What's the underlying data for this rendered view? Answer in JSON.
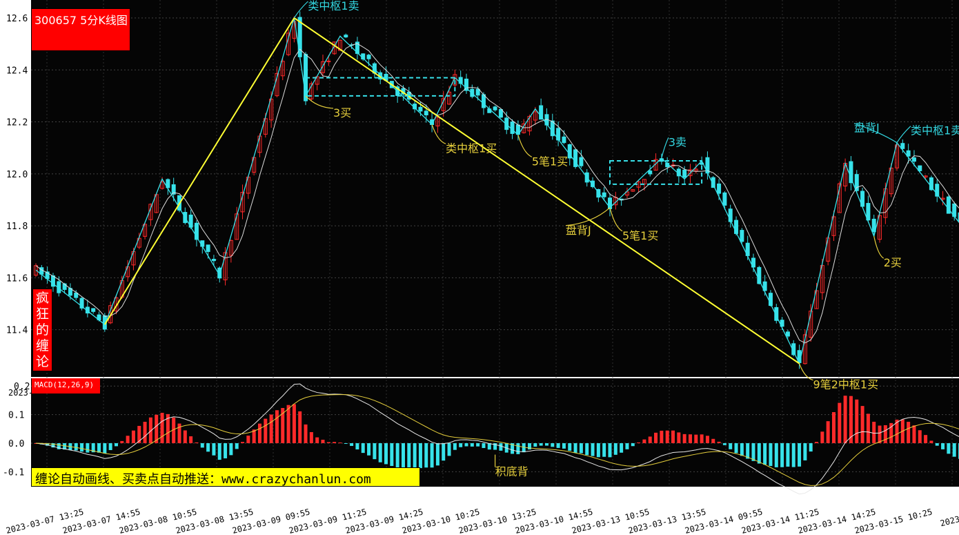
{
  "chart_data": {
    "type": "candlestick",
    "title": "300657 5分K线图",
    "side_label": "疯狂的缠论",
    "indicator_label": "MACD(12,26,9)",
    "promo_text": "缠论自动画线、买卖点自动推送：www.crazychanlun.com",
    "y_ticks": [
      "12.6",
      "12.4",
      "12.2",
      "12.0",
      "11.8",
      "11.6",
      "11.4"
    ],
    "ylim": [
      11.25,
      12.65
    ],
    "macd_ticks": [
      "0.2",
      "0.1",
      "0.0",
      "-0.1"
    ],
    "macd_ylim": [
      -0.13,
      0.21
    ],
    "x_ticks": [
      "2023-03-07 13:25",
      "2023-03-07 14:55",
      "2023-03-08 10:55",
      "2023-03-08 13:55",
      "2023-03-09 09:55",
      "2023-03-09 11:25",
      "2023-03-09 14:25",
      "2023-03-10 10:25",
      "2023-03-10 13:25",
      "2023-03-10 14:55",
      "2023-03-13 10:55",
      "2023-03-13 13:55",
      "2023-03-14 09:55",
      "2023-03-14 11:25",
      "2023-03-14 14:25",
      "2023-03-15 10:25",
      "2023-03-15"
    ],
    "x_tick_partial": "2023-",
    "bi_points": [
      {
        "i": 0,
        "p": 11.63
      },
      {
        "i": 12,
        "p": 11.42
      },
      {
        "i": 22,
        "p": 11.98
      },
      {
        "i": 32,
        "p": 11.61
      },
      {
        "i": 45,
        "p": 12.6
      },
      {
        "i": 47,
        "p": 12.3
      },
      {
        "i": 53,
        "p": 12.53
      },
      {
        "i": 69,
        "p": 12.19
      },
      {
        "i": 73,
        "p": 12.37
      },
      {
        "i": 84,
        "p": 12.15
      },
      {
        "i": 87,
        "p": 12.25
      },
      {
        "i": 100,
        "p": 11.87
      },
      {
        "i": 109,
        "p": 12.06
      },
      {
        "i": 113,
        "p": 11.98
      },
      {
        "i": 116,
        "p": 12.05
      },
      {
        "i": 133,
        "p": 11.27
      },
      {
        "i": 141,
        "p": 12.04
      },
      {
        "i": 146,
        "p": 11.76
      },
      {
        "i": 150,
        "p": 12.12
      },
      {
        "i": 162,
        "p": 11.78
      }
    ],
    "segment_points": [
      {
        "i": 12,
        "p": 11.42
      },
      {
        "i": 45,
        "p": 12.6
      },
      {
        "i": 133,
        "p": 11.27
      }
    ],
    "zhongshu": [
      {
        "i0": 47,
        "i1": 73,
        "low": 12.3,
        "high": 12.37
      },
      {
        "i0": 100,
        "i1": 116,
        "low": 11.96,
        "high": 12.05
      }
    ],
    "annotations": [
      {
        "text": "类中枢1卖",
        "color": "#33d6e0",
        "i": 45,
        "p": 12.6
      },
      {
        "text": "3买",
        "color": "#e6cf3c",
        "i": 47,
        "p": 12.3
      },
      {
        "text": "类中枢1买",
        "color": "#e6cf3c",
        "i": 69,
        "p": 12.19
      },
      {
        "text": "5笔1买",
        "color": "#e6cf3c",
        "i": 84,
        "p": 12.15
      },
      {
        "text": "3卖",
        "color": "#33d6e0",
        "i": 109,
        "p": 12.06
      },
      {
        "text": "盘背J",
        "color": "#e6cf3c",
        "i": 100,
        "p": 11.87
      },
      {
        "text": "5笔1买",
        "color": "#e6cf3c",
        "i": 100,
        "p": 11.87
      },
      {
        "text": "9笔2中枢1买",
        "color": "#e6cf3c",
        "i": 133,
        "p": 11.27
      },
      {
        "text": "盘背J",
        "color": "#33d6e0",
        "i": 150,
        "p": 12.12
      },
      {
        "text": "类中枢1卖",
        "color": "#33d6e0",
        "i": 150,
        "p": 12.12
      },
      {
        "text": "2买",
        "color": "#e6cf3c",
        "i": 146,
        "p": 11.76
      },
      {
        "text": "积底背",
        "color": "#e6cf3c",
        "i": 80,
        "p": -0.04
      }
    ],
    "colors": {
      "up": "#ff2a2a",
      "down": "#37e2ea",
      "bi": "#37e2ea",
      "segment": "#ffff33",
      "zhongshu": "#37e2ea",
      "grid": "#444444",
      "axis_text": "#000000",
      "background": "#050505",
      "dif": "#e8e8e8",
      "dea": "#e6cf3c"
    }
  }
}
